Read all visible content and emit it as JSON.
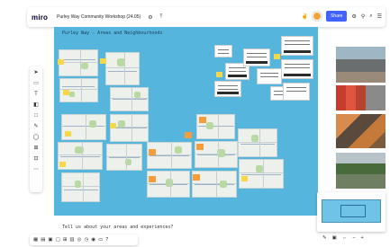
{
  "app": {
    "logo": "miro",
    "board_title": "Purley Way Community Workshop (24.05)",
    "share_label": "Share"
  },
  "canvas": {
    "frame_title": "Purley Way - Areas and Neighbourhoods",
    "prompt": "Tell us about your areas and experiences?"
  },
  "colors": {
    "canvas": "#55b5dc",
    "accent": "#4262ff",
    "sticky": "#f7d74a",
    "sticky_orange": "#f59d3b"
  },
  "toolbar": {
    "icons": [
      "cursor-icon",
      "frame-icon",
      "text-icon",
      "sticky-note-icon",
      "shape-icon",
      "pen-icon",
      "comment-icon",
      "crop-icon",
      "upload-icon",
      "more-icon"
    ]
  },
  "bottom_toolbar": {
    "icons": [
      "grid-icon",
      "chart-icon",
      "present-icon",
      "comment-icon",
      "table-icon",
      "board-icon",
      "voting-icon",
      "timer-icon",
      "video-icon",
      "screenshare-icon",
      "help-icon"
    ]
  }
}
